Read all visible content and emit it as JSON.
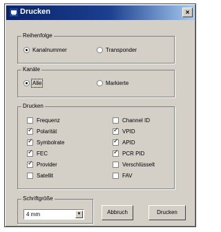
{
  "window": {
    "title": "Drucken",
    "close_symbol": "×"
  },
  "reihenfolge": {
    "legend": "Reihenfolge",
    "options": [
      {
        "label": "Kanalnummer",
        "selected": true
      },
      {
        "label": "Transponder",
        "selected": false
      }
    ]
  },
  "kanaele": {
    "legend": "Kanäle",
    "options": [
      {
        "label": "Alle",
        "selected": true
      },
      {
        "label": "Markierte",
        "selected": false
      }
    ]
  },
  "drucken": {
    "legend": "Drucken",
    "left": [
      {
        "label": "Frequenz",
        "checked": false
      },
      {
        "label": "Polarität",
        "checked": true
      },
      {
        "label": "Symbolrate",
        "checked": true
      },
      {
        "label": "FEC",
        "checked": true
      },
      {
        "label": "Provider",
        "checked": true
      },
      {
        "label": "Satellit",
        "checked": false
      }
    ],
    "right": [
      {
        "label": "Channel ID",
        "checked": false
      },
      {
        "label": "VPID",
        "checked": true
      },
      {
        "label": "APID",
        "checked": true
      },
      {
        "label": "PCR PID",
        "checked": true
      },
      {
        "label": "Verschlüsselt",
        "checked": false
      },
      {
        "label": "FAV",
        "checked": false
      }
    ]
  },
  "schriftgroesse": {
    "legend": "Schriftgröße",
    "value": "4 mm",
    "arrow": "▼"
  },
  "buttons": {
    "cancel": "Abbruch",
    "print": "Drucken"
  }
}
